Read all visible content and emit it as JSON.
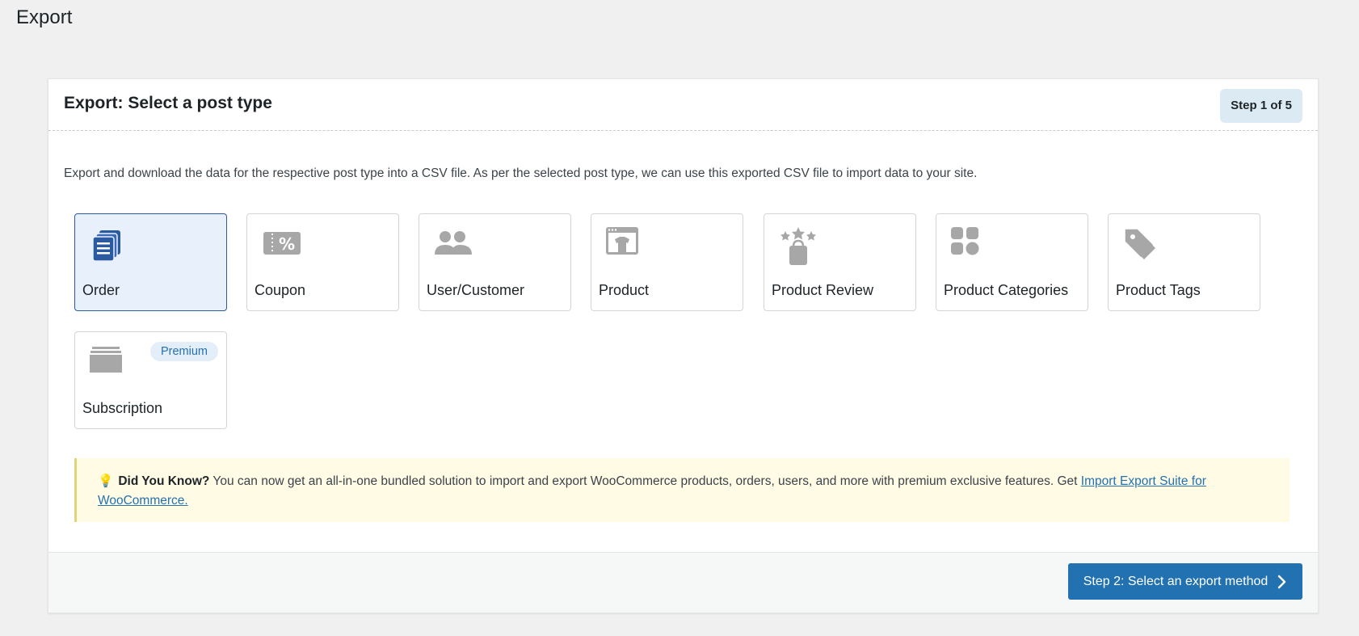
{
  "page": {
    "title": "Export"
  },
  "panel": {
    "title": "Export: Select a post type",
    "step_badge": "Step 1 of 5",
    "description": "Export and download the data for the respective post type into a CSV file. As per the selected post type, we can use this exported CSV file to import data to your site."
  },
  "post_types": [
    {
      "label": "Order",
      "icon": "order-stack-icon",
      "selected": true
    },
    {
      "label": "Coupon",
      "icon": "coupon-icon",
      "selected": false
    },
    {
      "label": "User/Customer",
      "icon": "users-icon",
      "selected": false
    },
    {
      "label": "Product",
      "icon": "product-shirt-icon",
      "selected": false
    },
    {
      "label": "Product Review",
      "icon": "review-stars-bag-icon",
      "selected": false
    },
    {
      "label": "Product Categories",
      "icon": "categories-grid-icon",
      "selected": false
    },
    {
      "label": "Product Tags",
      "icon": "tag-icon",
      "selected": false
    },
    {
      "label": "Subscription",
      "icon": "subscription-stack-icon",
      "selected": false,
      "badge": "Premium"
    }
  ],
  "notice": {
    "icon": "lightbulb-icon",
    "heading": "Did You Know?",
    "text": " You can now get an all-in-one bundled solution to import and export WooCommerce products, orders, users, and more with premium exclusive features. Get ",
    "link_text": "Import Export Suite for WooCommerce."
  },
  "footer": {
    "next_button": "Step 2: Select an export method"
  },
  "colors": {
    "accent": "#2271b1",
    "selected_bg": "#e8f0fc",
    "icon_gray": "#a7a7a7",
    "order_icon": "#2c5aa0",
    "notice_bg": "#fffbe5"
  }
}
